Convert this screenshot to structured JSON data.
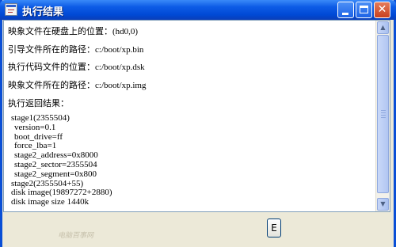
{
  "window": {
    "title": "执行结果"
  },
  "titlebar_buttons": {
    "min": "minimize-icon",
    "max": "maximize-icon",
    "close": "✕"
  },
  "info": [
    {
      "label": "映象文件在硬盘上的位置：",
      "value": "(hd0,0)"
    },
    {
      "label": "引导文件所在的路径：",
      "value": "c:/boot/xp.bin"
    },
    {
      "label": "执行代码文件的位置：",
      "value": "c:/boot/xp.dsk"
    },
    {
      "label": "映象文件所在的路径：",
      "value": "c:/boot/xp.img"
    }
  ],
  "result_label": "执行返回结果：",
  "output_lines": [
    "stage1(2355504)",
    " version=0.1",
    " boot_drive=ff",
    " force_lba=1",
    " stage2_address=0x8000",
    " stage2_sector=2355504",
    " stage2_segment=0x800",
    "stage2(2355504+55)",
    "disk image(19897272+2880)",
    "disk image size 1440k"
  ],
  "bottom_button_label": "E",
  "watermark": "电脑百事网"
}
